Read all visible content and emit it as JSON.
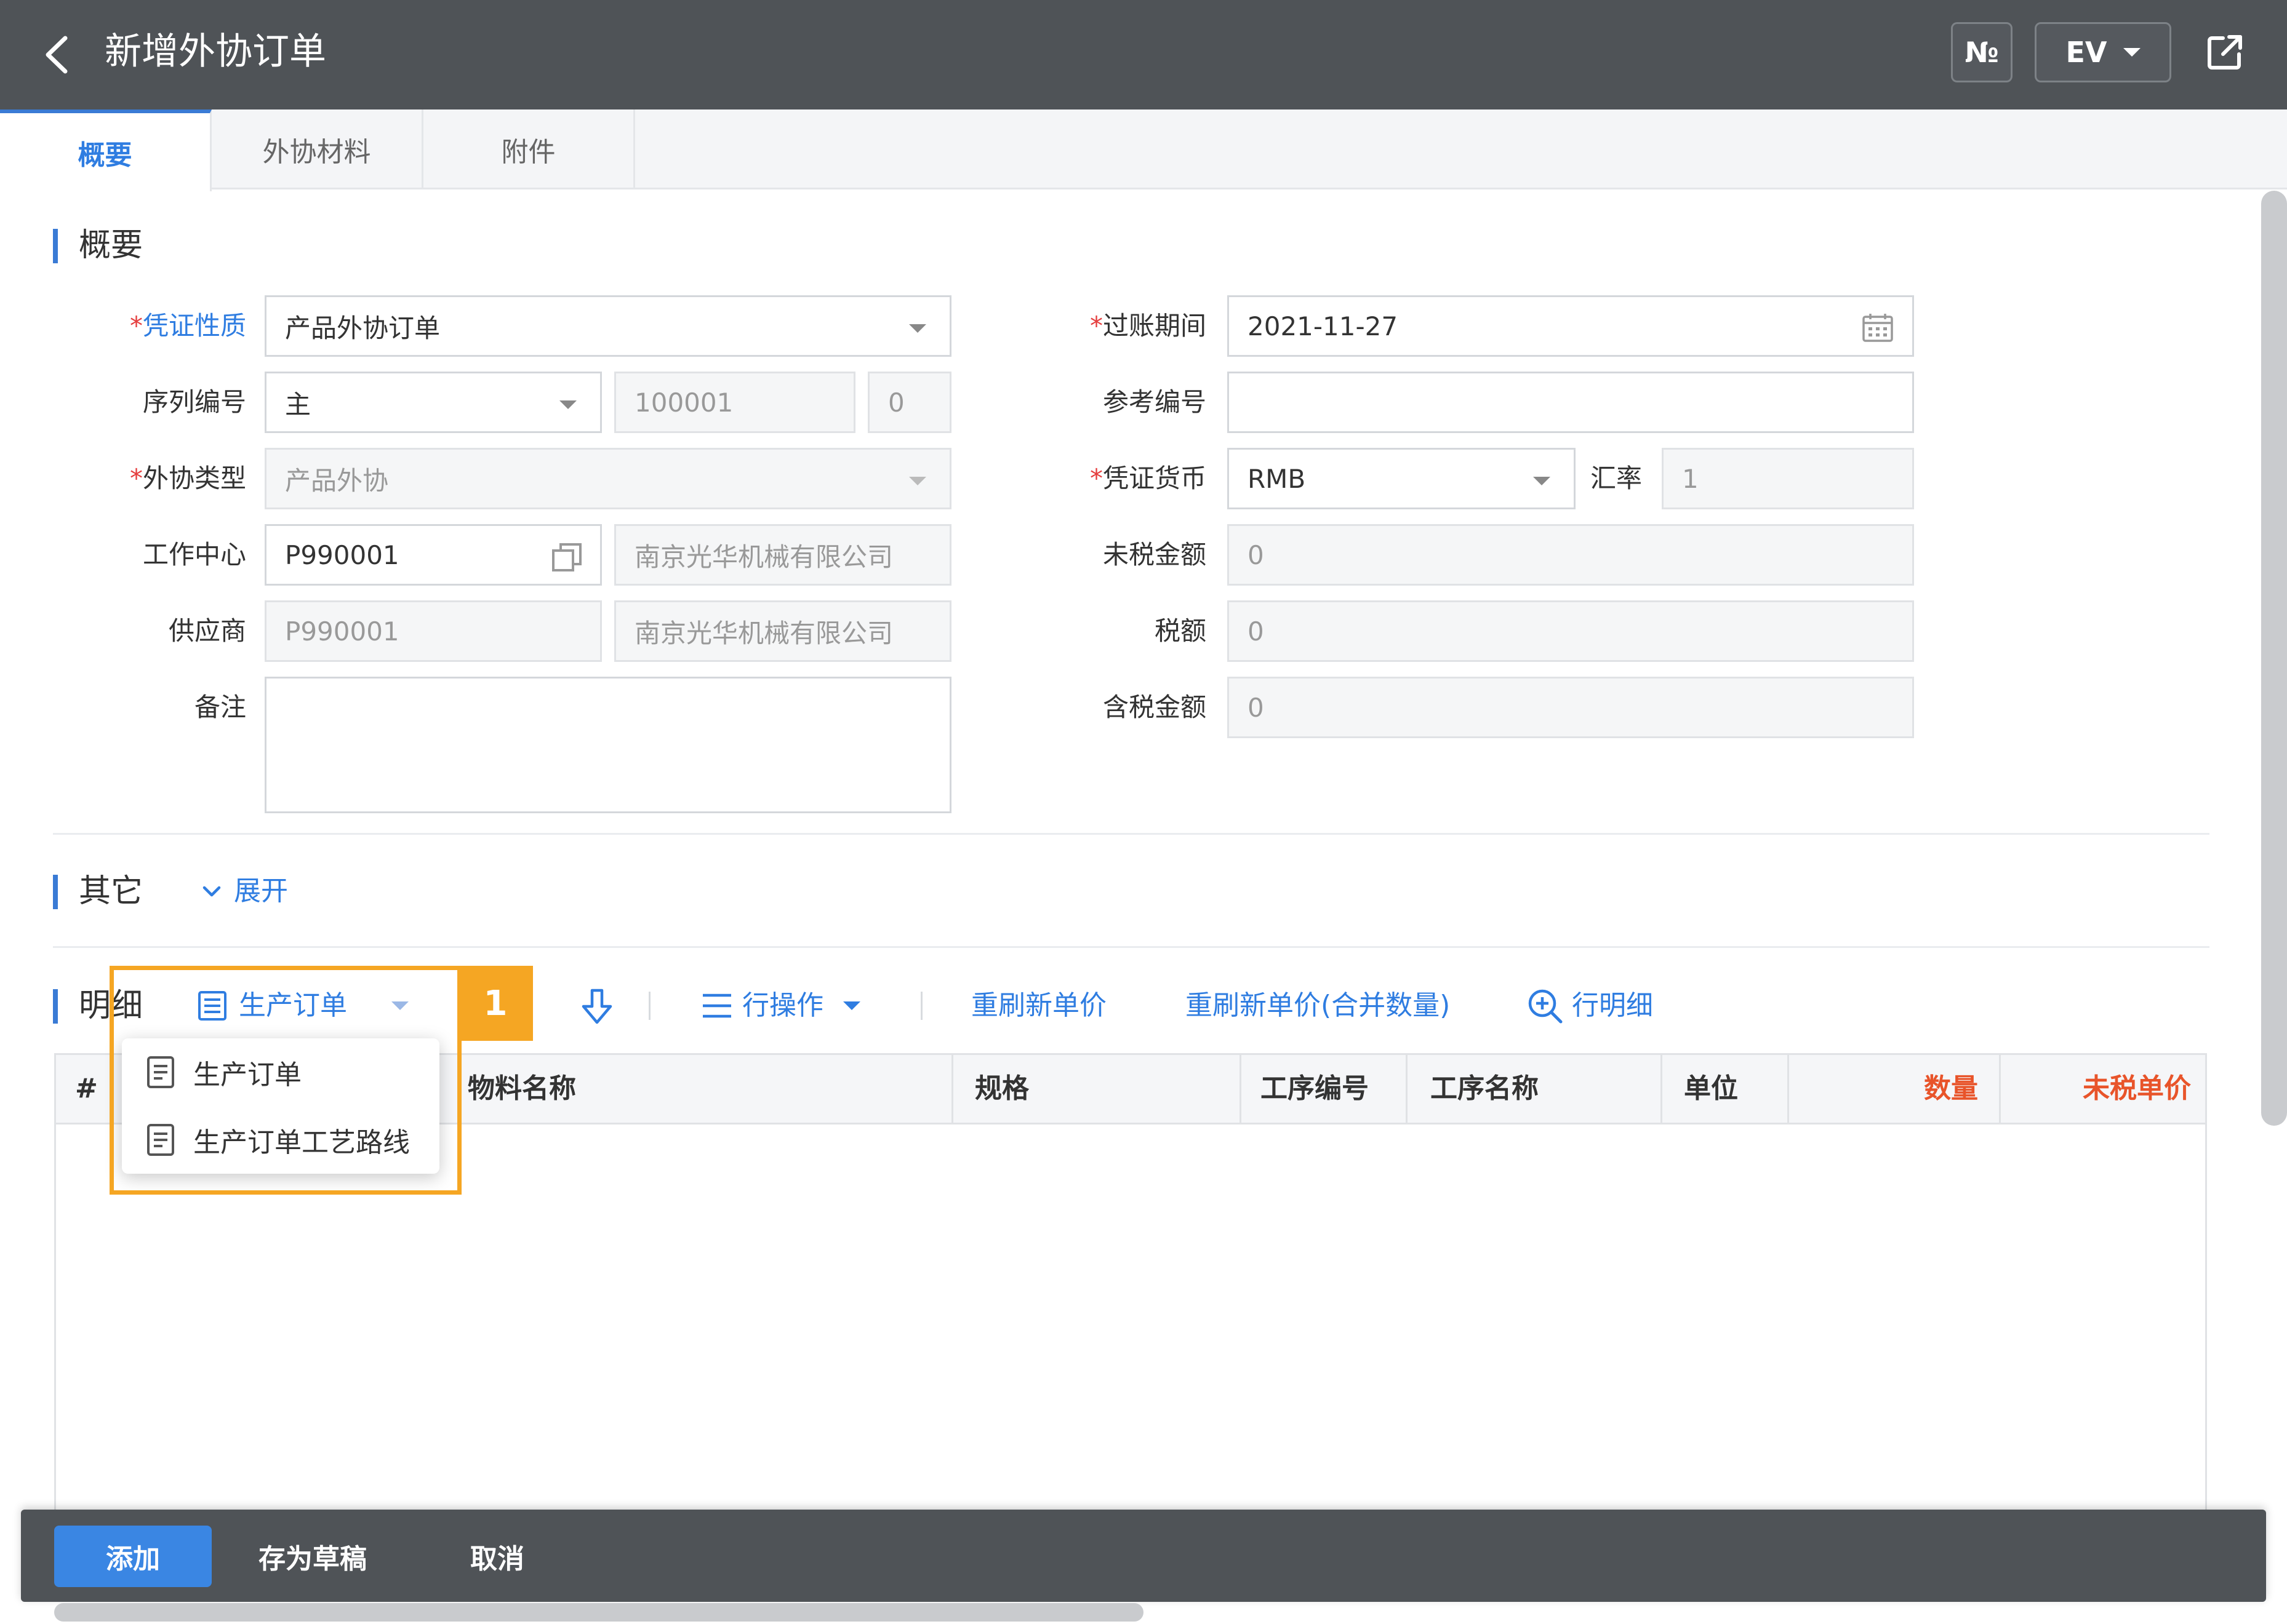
{
  "header": {
    "title": "新增外协订单",
    "btn_no": "№",
    "btn_ev": "EV"
  },
  "tabs": [
    {
      "label": "概要",
      "active": true
    },
    {
      "label": "外协材料",
      "active": false
    },
    {
      "label": "附件",
      "active": false
    }
  ],
  "sections": {
    "overview": "概要",
    "other": "其它",
    "other_expand": "展开",
    "detail": "明细"
  },
  "form": {
    "req_mark": "*",
    "voucher_type": {
      "label": "凭证性质",
      "value": "产品外协订单"
    },
    "serial_no": {
      "label": "序列编号",
      "value": "主",
      "number": "100001",
      "suffix": "0"
    },
    "outsource_type": {
      "label": "外协类型",
      "value": "产品外协"
    },
    "work_center": {
      "label": "工作中心",
      "code": "P990001",
      "name": "南京光华机械有限公司"
    },
    "supplier": {
      "label": "供应商",
      "code": "P990001",
      "name": "南京光华机械有限公司"
    },
    "remark": {
      "label": "备注",
      "value": ""
    },
    "posting_period": {
      "label": "过账期间",
      "value": "2021-11-27"
    },
    "ref_no": {
      "label": "参考编号",
      "value": ""
    },
    "currency": {
      "label": "凭证货币",
      "value": "RMB"
    },
    "rate": {
      "label": "汇率",
      "value": "1"
    },
    "untaxed_amount": {
      "label": "未税金额",
      "value": "0"
    },
    "tax": {
      "label": "税额",
      "value": "0"
    },
    "taxed_amount": {
      "label": "含税金额",
      "value": "0"
    }
  },
  "toolbar": {
    "production_order": "生产订单",
    "row_ops": "行操作",
    "refresh_price": "重刷新单价",
    "refresh_price_merge": "重刷新单价(合并数量)",
    "row_detail": "行明细"
  },
  "highlight_badge": "1",
  "dropdown_items": [
    "生产订单",
    "生产订单工艺路线"
  ],
  "table": {
    "columns": [
      "#",
      "物料名称",
      "规格",
      "工序编号",
      "工序名称",
      "单位",
      "数量",
      "未税单价"
    ]
  },
  "actions": {
    "add": "添加",
    "save_draft": "存为草稿",
    "cancel": "取消"
  },
  "colors": {
    "accent": "#3a7bd5",
    "header_bg": "#4f5357",
    "highlight": "#f5a623",
    "required": "#e53e3e",
    "qty_header": "#e8542a"
  }
}
